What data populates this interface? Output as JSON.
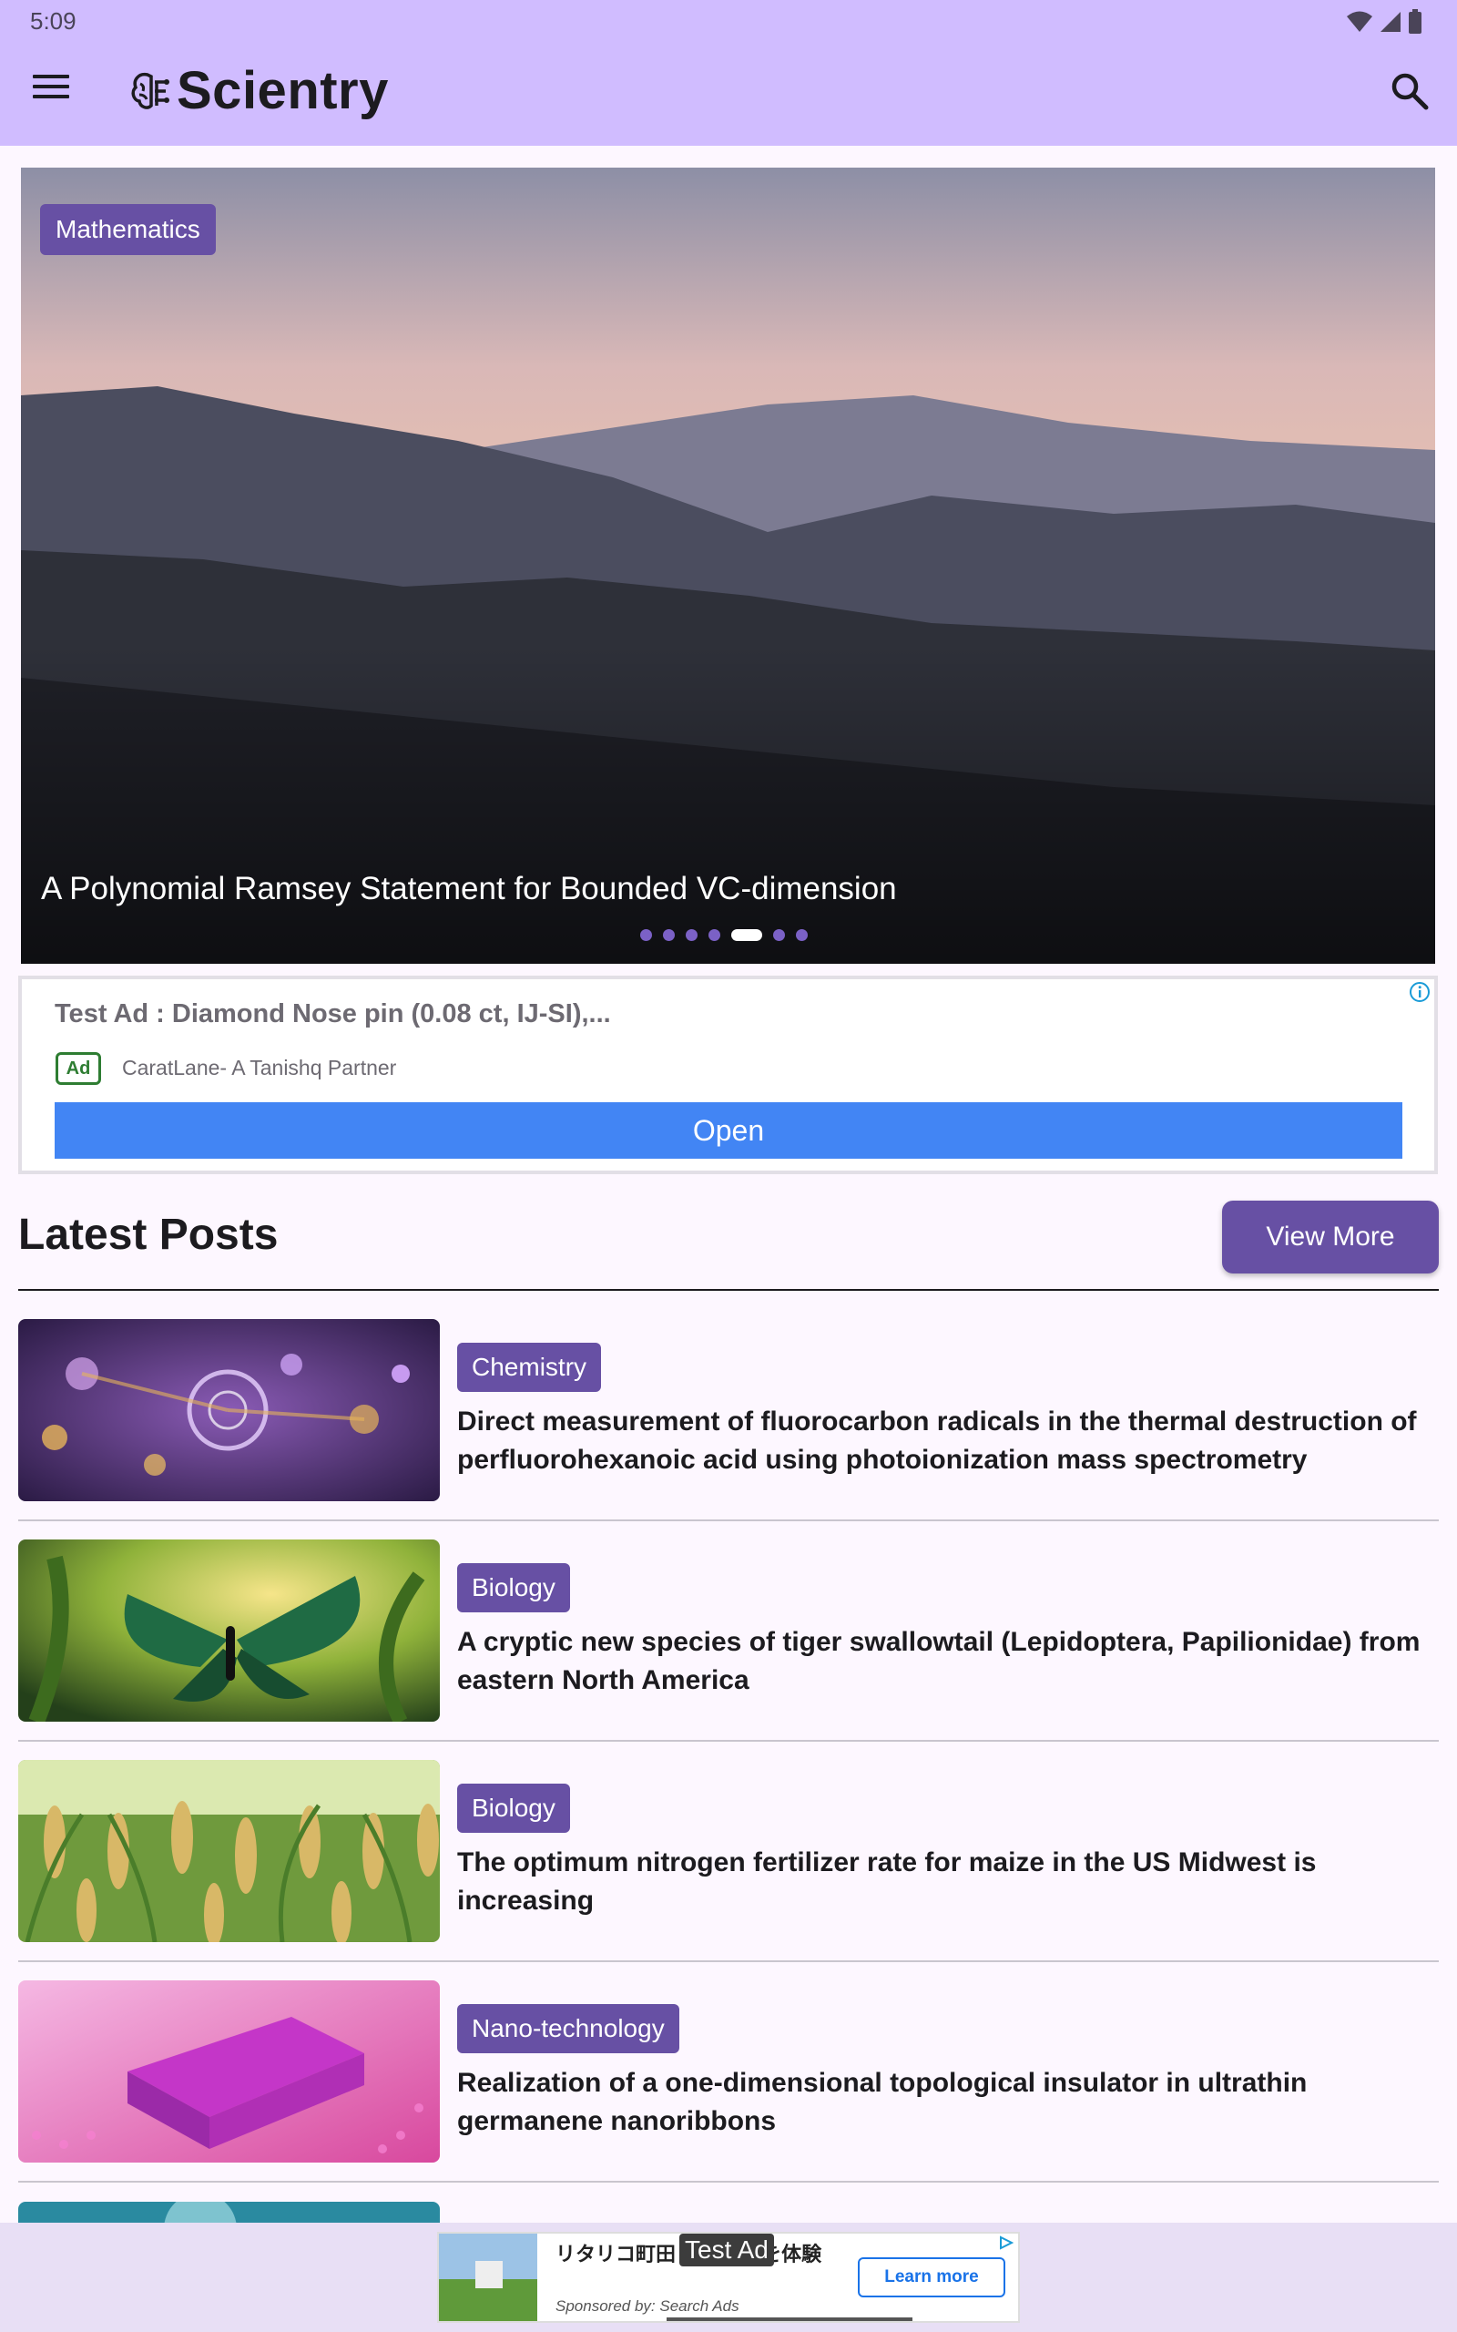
{
  "status_bar": {
    "time": "5:09"
  },
  "app_bar": {
    "title": "Scientry"
  },
  "hero": {
    "category": "Mathematics",
    "title": "A Polynomial Ramsey Statement for Bounded VC-dimension",
    "slide_count": 7,
    "active_slide": 5
  },
  "ad": {
    "title": "Test Ad : Diamond Nose pin (0.08 ct, IJ-SI),...",
    "badge": "Ad",
    "advertiser": "CaratLane- A Tanishq Partner",
    "button": "Open"
  },
  "latest": {
    "heading": "Latest Posts",
    "view_more": "View More",
    "posts": [
      {
        "category": "Chemistry",
        "title": "Direct measurement of fluorocarbon radicals in the thermal destruction of perfluorohexanoic acid using photoionization mass spectrometry"
      },
      {
        "category": "Biology",
        "title": "A cryptic new species of tiger swallowtail (Lepidoptera, Papilionidae) from eastern North America"
      },
      {
        "category": "Biology",
        "title": "The optimum nitrogen fertilizer rate for maize in the US Midwest is increasing"
      },
      {
        "category": "Nano-technology",
        "title": "Realization of a one-dimensional topological insulator in ultrathin germanene nanoribbons"
      }
    ]
  },
  "banner_ad": {
    "text": "リタリコ町田 学びの形を体験",
    "label": "Test Ad",
    "sponsor": "Sponsored by: Search Ads",
    "button": "Learn more"
  },
  "colors": {
    "app_bar": "#d0bcff",
    "primary": "#6750a4",
    "ad_button": "#4285f4"
  }
}
